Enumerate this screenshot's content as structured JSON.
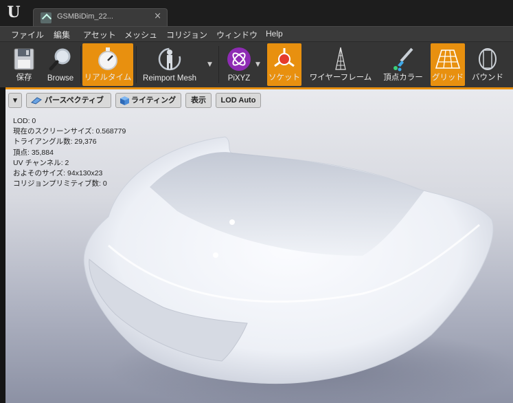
{
  "titlebar": {
    "app_logo": "U",
    "tab_title": "GSMBiDim_22...",
    "tab_close": "×"
  },
  "menu": [
    "ファイル",
    "編集",
    "アセット",
    "メッシュ",
    "コリジョン",
    "ウィンドウ",
    "Help"
  ],
  "toolbar": {
    "save": "保存",
    "browse": "Browse",
    "realtime": "リアルタイム",
    "reimport": "Reimport Mesh",
    "pixyz": "PiXYZ",
    "socket": "ソケット",
    "wireframe": "ワイヤーフレーム",
    "vertex_color": "頂点カラー",
    "grid": "グリッド",
    "bounds": "バウンド"
  },
  "viewport": {
    "perspective": "パースペクティブ",
    "lighting": "ライティング",
    "show": "表示",
    "lod": "LOD Auto"
  },
  "stats": [
    "LOD: 0",
    "現在のスクリーンサイズ: 0.568779",
    "トライアングル数: 29,376",
    "頂点: 35,884",
    "UV チャンネル: 2",
    "およそのサイズ: 94x130x23",
    "コリジョンプリミティブ数: 0"
  ],
  "colors": {
    "accent": "#e8900f",
    "pixyz": "#8e2bb4"
  }
}
